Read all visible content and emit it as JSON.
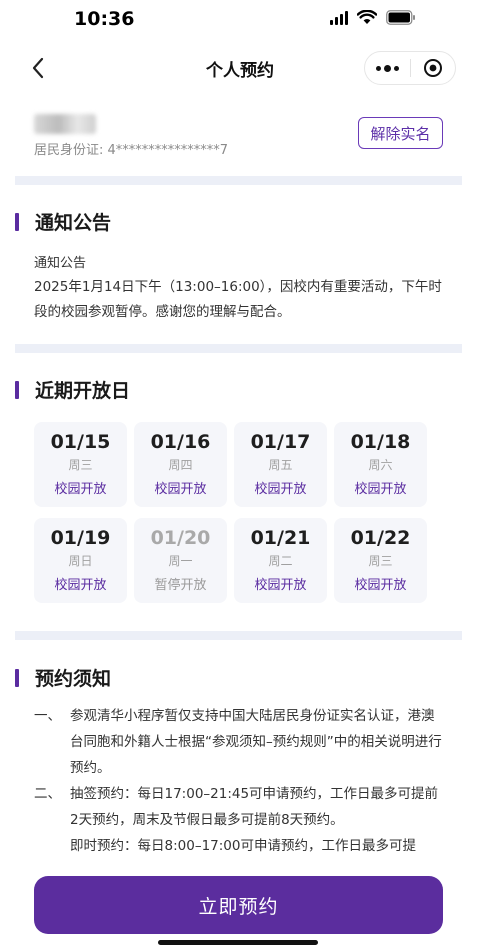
{
  "status_bar": {
    "time": "10:36"
  },
  "nav": {
    "title": "个人预约"
  },
  "user": {
    "id_text": "居民身份证: 4****************7",
    "unbind_label": "解除实名"
  },
  "notice": {
    "title": "通知公告",
    "label": "通知公告",
    "body": "2025年1月14日下午（13:00–16:00），因校内有重要活动，下午时段的校园参观暂停。感谢您的理解与配合。"
  },
  "open_days": {
    "title": "近期开放日",
    "days": [
      {
        "date": "01/15",
        "weekday": "周三",
        "status": "校园开放",
        "open": true
      },
      {
        "date": "01/16",
        "weekday": "周四",
        "status": "校园开放",
        "open": true
      },
      {
        "date": "01/17",
        "weekday": "周五",
        "status": "校园开放",
        "open": true
      },
      {
        "date": "01/18",
        "weekday": "周六",
        "status": "校园开放",
        "open": true
      },
      {
        "date": "01/19",
        "weekday": "周日",
        "status": "校园开放",
        "open": true
      },
      {
        "date": "01/20",
        "weekday": "周一",
        "status": "暂停开放",
        "open": false
      },
      {
        "date": "01/21",
        "weekday": "周二",
        "status": "校园开放",
        "open": true
      },
      {
        "date": "01/22",
        "weekday": "周三",
        "status": "校园开放",
        "open": true
      }
    ]
  },
  "rules": {
    "title": "预约须知",
    "items": [
      {
        "num": "一、",
        "text": "参观清华小程序暂仅支持中国大陆居民身份证实名认证，港澳台同胞和外籍人士根据“参观须知–预约规则”中的相关说明进行预约。"
      },
      {
        "num": "二、",
        "text": "抽签预约：每日17:00–21:45可申请预约，工作日最多可提前2天预约，周末及节假日最多可提前8天预约。"
      }
    ],
    "extra": "即时预约：每日8:00–17:00可申请预约，工作日最多可提"
  },
  "action": {
    "book_label": "立即预约"
  },
  "colors": {
    "accent": "#5b2d9e",
    "divider": "#eceff7",
    "card": "#f5f6fa"
  }
}
